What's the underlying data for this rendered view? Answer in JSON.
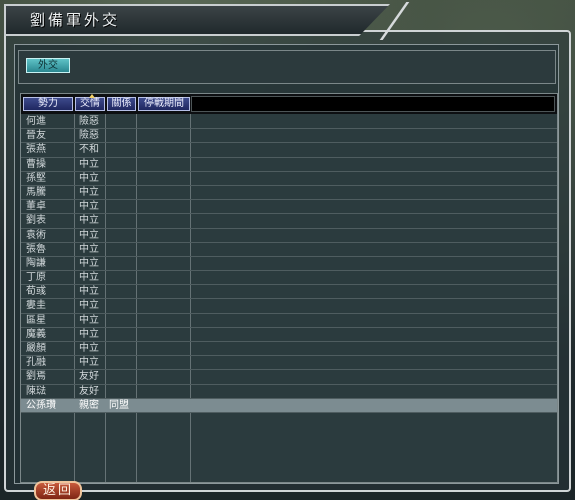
{
  "window": {
    "title": "劉備軍外交"
  },
  "top_panel": {
    "diplomacy_button": "外交"
  },
  "table": {
    "headers": [
      "勢力",
      "交情",
      "關係",
      "停戰期間"
    ],
    "rows": [
      [
        "何進",
        "險惡",
        ""
      ],
      [
        "晉友",
        "險惡",
        ""
      ],
      [
        "張燕",
        "不和",
        ""
      ],
      [
        "曹操",
        "中立",
        ""
      ],
      [
        "孫堅",
        "中立",
        ""
      ],
      [
        "馬騰",
        "中立",
        ""
      ],
      [
        "董卓",
        "中立",
        ""
      ],
      [
        "劉表",
        "中立",
        ""
      ],
      [
        "袁術",
        "中立",
        ""
      ],
      [
        "張魯",
        "中立",
        ""
      ],
      [
        "陶謙",
        "中立",
        ""
      ],
      [
        "丁原",
        "中立",
        ""
      ],
      [
        "荀彧",
        "中立",
        ""
      ],
      [
        "婁圭",
        "中立",
        ""
      ],
      [
        "區星",
        "中立",
        ""
      ],
      [
        "魔義",
        "中立",
        ""
      ],
      [
        "嚴顏",
        "中立",
        ""
      ],
      [
        "孔融",
        "中立",
        ""
      ],
      [
        "劉焉",
        "友好",
        ""
      ],
      [
        "陳琺",
        "友好",
        ""
      ],
      [
        "公孫瓚",
        "親密",
        "同盟"
      ]
    ],
    "selected_index": 20
  },
  "footer": {
    "back_button": "返回"
  }
}
